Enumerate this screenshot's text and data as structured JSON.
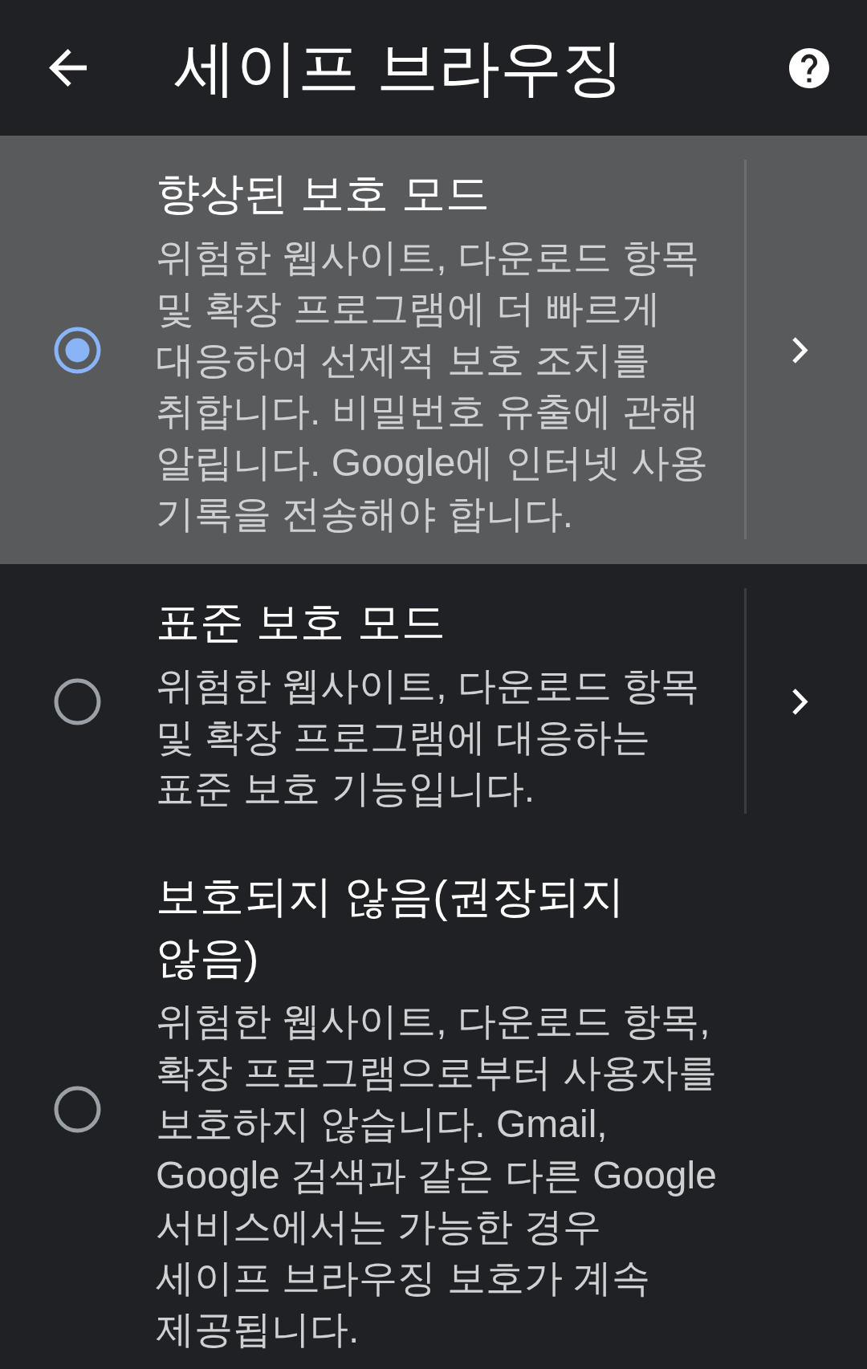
{
  "app_bar": {
    "title": "세이프 브라우징"
  },
  "options": [
    {
      "title": "향상된 보호 모드",
      "description": "위험한 웹사이트, 다운로드 항목 및 확장 프로그램에 더 빠르게 대응하여 선제적 보호 조치를 취합니다. 비밀번호 유출에 관해 알립니다. Google에 인터넷 사용 기록을 전송해야 합니다.",
      "selected": true,
      "has_details": true
    },
    {
      "title": "표준 보호 모드",
      "description": "위험한 웹사이트, 다운로드 항목 및 확장 프로그램에 대응하는 표준 보호 기능입니다.",
      "selected": false,
      "has_details": true
    },
    {
      "title": "보호되지 않음(권장되지 않음)",
      "description": "위험한 웹사이트, 다운로드 항목, 확장 프로그램으로부터 사용자를 보호하지 않습니다. Gmail, Google 검색과 같은 다른 Google 서비스에서는 가능한 경우 세이프 브라우징 보호가 계속 제공됩니다.",
      "selected": false,
      "has_details": false
    }
  ]
}
